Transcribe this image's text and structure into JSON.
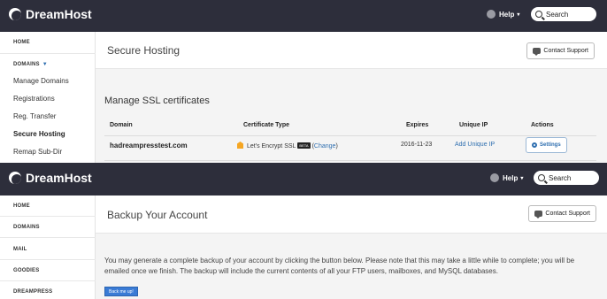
{
  "top": {
    "brand": "DreamHost",
    "help_label": "Help",
    "search_placeholder": "Search"
  },
  "ssl_view": {
    "sidebar": {
      "home": "HOME",
      "domains": "DOMAINS",
      "items": [
        "Manage Domains",
        "Registrations",
        "Reg. Transfer",
        "Secure Hosting",
        "Remap Sub-Dir"
      ]
    },
    "page_title": "Secure Hosting",
    "contact_support": "Contact Support",
    "section_title": "Manage SSL certificates",
    "table": {
      "headers": [
        "Domain",
        "Certificate Type",
        "Expires",
        "Unique IP",
        "Actions"
      ],
      "rows": [
        {
          "domain": "hadreampresstest.com",
          "cert_type": "Let's Encrypt SSL",
          "beta_badge": "BETA",
          "change_open": "(",
          "change_link": "Change",
          "change_close": ")",
          "expires": "2016-11-23",
          "unique_ip_link": "Add Unique IP",
          "action_label": "Settings"
        }
      ]
    }
  },
  "backup_view": {
    "sidebar": {
      "items": [
        "HOME",
        "DOMAINS",
        "MAIL",
        "GOODIES",
        "DREAMPRESS"
      ]
    },
    "page_title": "Backup Your Account",
    "contact_support": "Contact Support",
    "description": "You may generate a complete backup of your account by clicking the button below. Please note that this may take a little while to complete; you will be emailed once we finish. The backup will include the current contents of all your FTP users, mailboxes, and MySQL databases.",
    "backup_button": "Back me up!"
  },
  "colors": {
    "topbar": "#2d2e3b",
    "link": "#2f6fb0",
    "button_primary": "#3a7bd5"
  }
}
